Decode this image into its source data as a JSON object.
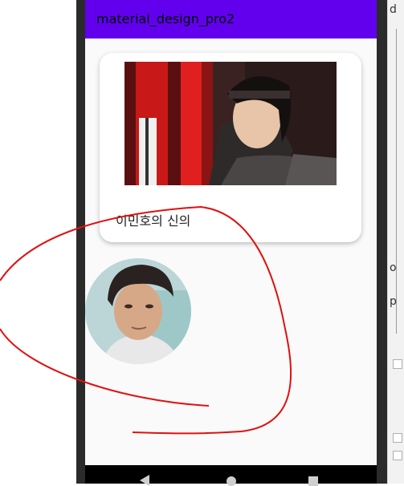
{
  "app": {
    "title": "material_design_pro2"
  },
  "card": {
    "image_icon": "portrait-photo",
    "caption": "이민호의 신의"
  },
  "avatar": {
    "image_icon": "portrait-photo"
  },
  "nav": {
    "back_icon": "back-triangle-icon",
    "home_icon": "home-circle-icon",
    "recent_icon": "recent-square-icon"
  },
  "side_panel": {
    "label_top": "d",
    "label_mid1": "o",
    "label_mid2": "p"
  },
  "colors": {
    "app_bar": "#6200ee",
    "background": "#fafafa",
    "annotation_stroke": "#e01010"
  }
}
